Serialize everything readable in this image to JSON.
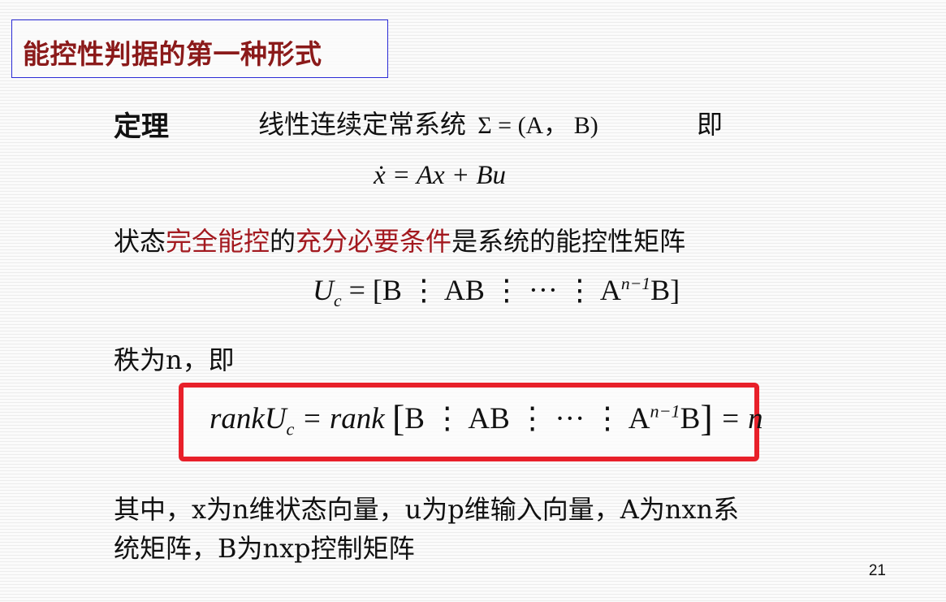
{
  "title": "能控性判据的第一种形式",
  "theorem": {
    "label": "定理",
    "statement": "线性连续定常系统",
    "system_symbol": "Σ = (A， B)",
    "ji": "即"
  },
  "state_equation": "ẋ = Ax + Bu",
  "condition": {
    "part1": "状态",
    "part2_red": "完全能控",
    "part3": "的",
    "part4_red": "充分必要条件",
    "part5": "是系统的能控性矩阵"
  },
  "controllability_matrix": {
    "lhs_U": "U",
    "lhs_sub": "c",
    "rhs_pre": "= [B ⋮ AB ⋮ ··· ⋮ A",
    "rhs_sup": "n−1",
    "rhs_post": "B]"
  },
  "rank_intro": "秩为n，即",
  "rank_formula": {
    "part1": "rankU",
    "sub": "c",
    "part2": "= rank",
    "bracket_content_pre": "B ⋮ AB ⋮ ··· ⋮ A",
    "sup": "n−1",
    "bracket_content_post": "B",
    "part3": "= n"
  },
  "note_line1": "其中，x为n维状态向量，u为p维输入向量，A为nxn系",
  "note_line2": "统矩阵，B为nxp控制矩阵",
  "page_number": "21"
}
